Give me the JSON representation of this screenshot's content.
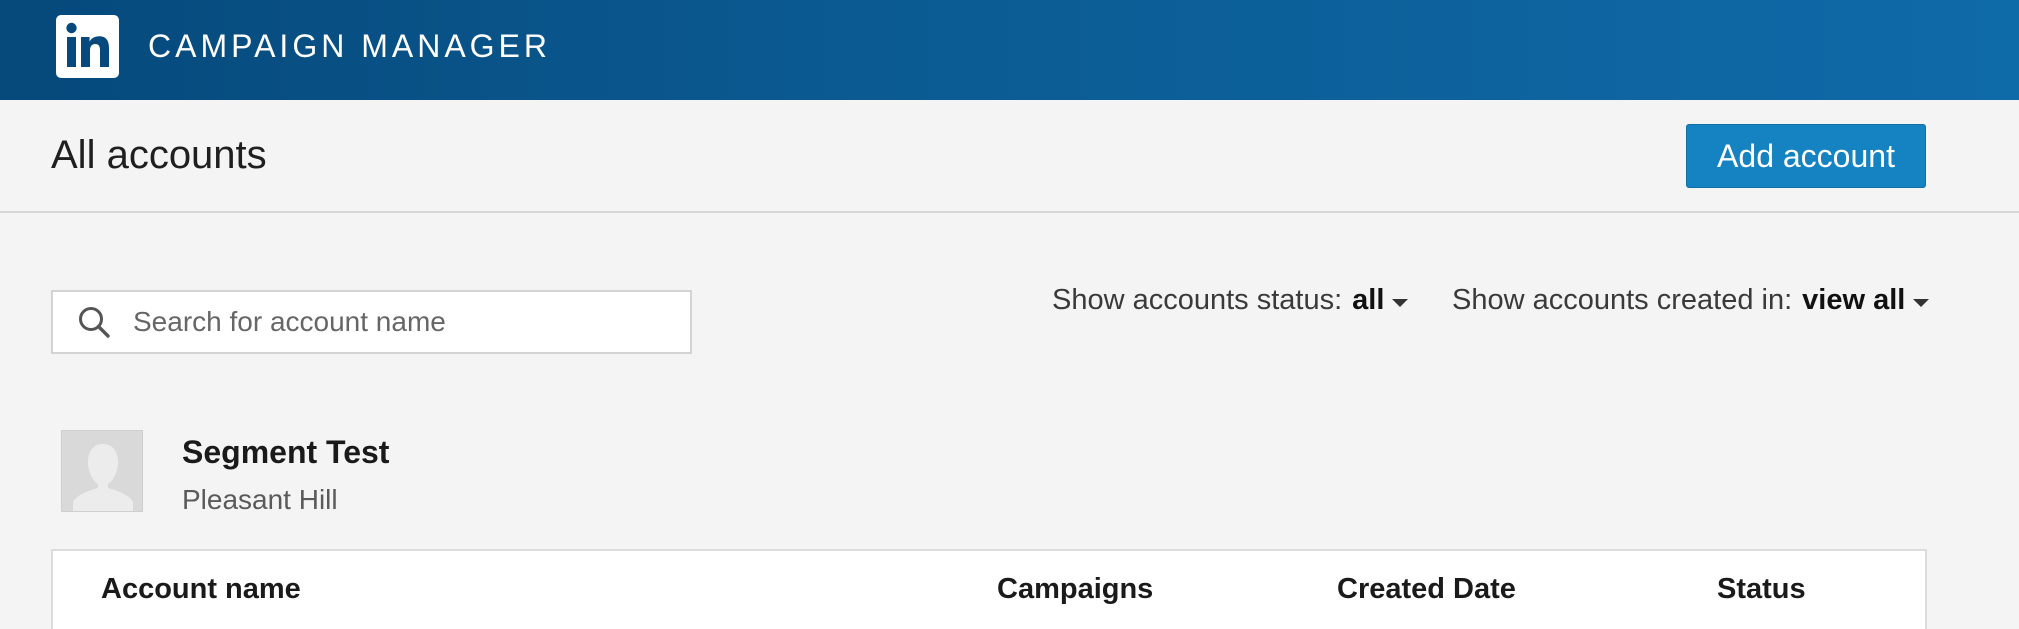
{
  "app": {
    "title": "CAMPAIGN MANAGER",
    "logo_text": "in",
    "brand_color": "#0a5a91"
  },
  "header": {
    "page_title": "All accounts",
    "add_account_label": "Add account",
    "accent_color": "#1582c1"
  },
  "search": {
    "placeholder": "Search for account name",
    "value": ""
  },
  "filters": {
    "status_label": "Show accounts status:",
    "status_value": "all",
    "created_label": "Show accounts created in:",
    "created_value": "view all"
  },
  "account": {
    "name": "Segment Test",
    "location": "Pleasant Hill",
    "avatar_icon": "default-profile-icon"
  },
  "table": {
    "columns": [
      "Account name",
      "Campaigns",
      "Created Date",
      "Status"
    ]
  }
}
